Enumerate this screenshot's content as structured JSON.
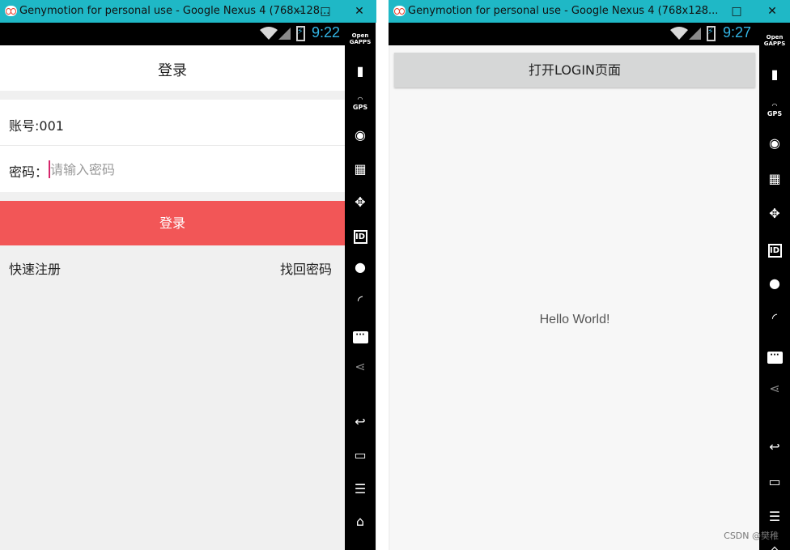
{
  "window1": {
    "title": "Genymotion for personal use - Google Nexus 4 (768x128...",
    "controls": {
      "minimize": "–",
      "maximize": "□",
      "close": "✕"
    },
    "status": {
      "time": "9:22"
    },
    "app": {
      "header_title": "登录",
      "account_label": "账号:001",
      "password_label": "密码：",
      "password_placeholder": "请输入密码",
      "login_button": "登录",
      "register_link": "快速注册",
      "forgot_link": "找回密码"
    }
  },
  "window2": {
    "title": "Genymotion for personal use - Google Nexus 4 (768x128...",
    "controls": {
      "minimize": "–",
      "maximize": "□",
      "close": "✕"
    },
    "status": {
      "time": "9:27"
    },
    "app": {
      "open_button": "打开LOGIN页面",
      "hello_text": "Hello World!"
    }
  },
  "sidebar": {
    "gapps_line1": "Open",
    "gapps_line2": "GAPPS",
    "gps_label": "GPS",
    "id_label": "ID",
    "icons": [
      "opengapps-icon",
      "battery-icon",
      "gps-icon",
      "webcam-icon",
      "capture-icon",
      "dpad-icon",
      "identifiers-icon",
      "disk-io-icon",
      "network-icon",
      "sms-icon",
      "share-icon",
      "back-icon",
      "recent-apps-icon",
      "menu-icon",
      "home-icon"
    ]
  },
  "watermark": "CSDN @樊稚"
}
